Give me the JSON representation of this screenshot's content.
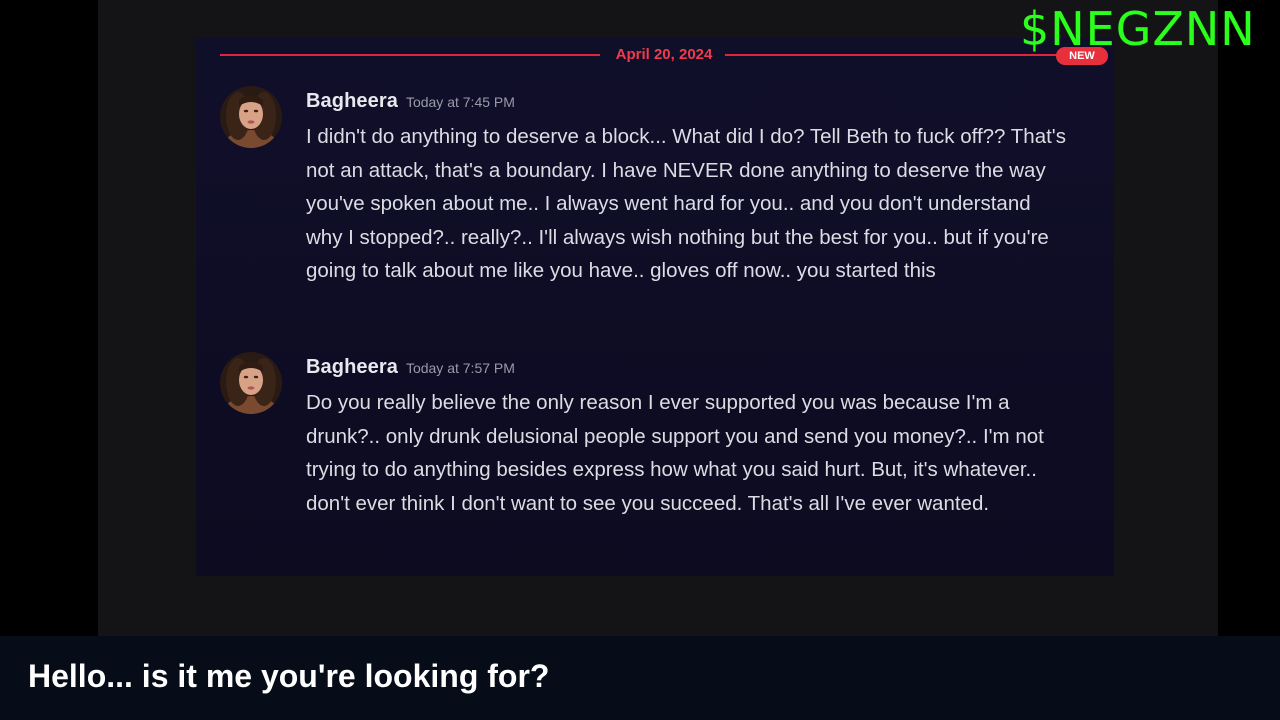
{
  "watermark": "$NEGZNN",
  "chat": {
    "divider_date": "April 20, 2024",
    "new_badge": "NEW",
    "messages": [
      {
        "author": "Bagheera",
        "timestamp": "Today at 7:45 PM",
        "text": "I didn't do anything to deserve a block... What did I do? Tell Beth to fuck off?? That's not an attack, that's a boundary. I have NEVER done anything to deserve the way you've spoken about me.. I always went hard for you.. and you don't understand why I stopped?.. really?.. I'll always wish nothing but the best for you.. but if you're going to talk about me like you have.. gloves off now.. you started this"
      },
      {
        "author": "Bagheera",
        "timestamp": "Today at 7:57 PM",
        "text": "Do you really believe the only reason I ever supported you was because I'm a drunk?.. only drunk delusional people support you and send you money?.. I'm not trying to do anything besides express how what you said hurt. But, it's whatever.. don't ever think I don't want to see you succeed. That's all I've ever wanted."
      }
    ]
  },
  "caption": "Hello... is it me you're looking for?",
  "colors": {
    "divider": "#e0243a",
    "badge": "#e8303c",
    "watermark": "#2cff1e",
    "chat_bg": "#0f0d25"
  }
}
